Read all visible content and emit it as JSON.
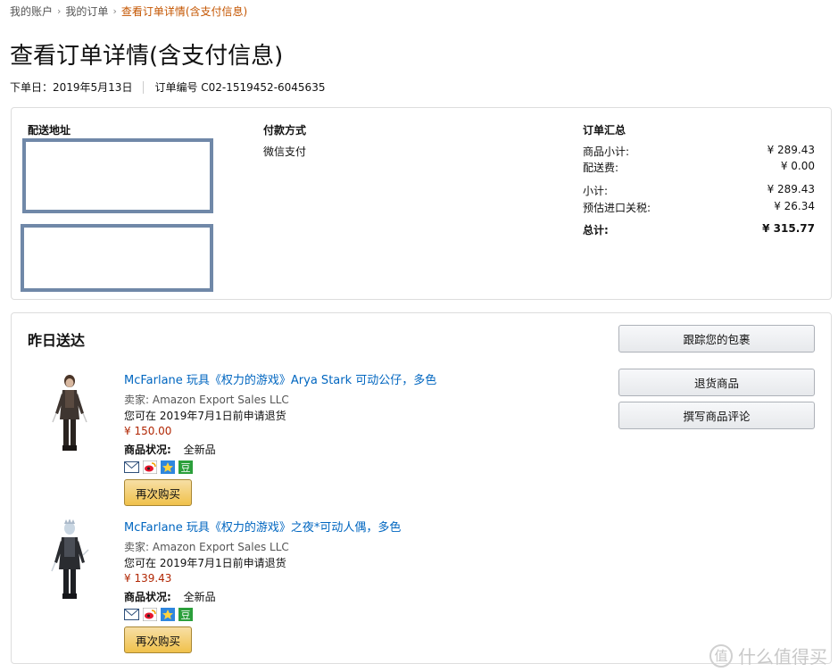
{
  "breadcrumb": {
    "items": [
      "我的账户",
      "我的订单",
      "查看订单详情(含支付信息)"
    ],
    "separator": "›"
  },
  "page": {
    "title": "查看订单详情(含支付信息)",
    "order_date": "下单日：2019年5月13日",
    "order_number": "订单编号 C02-1519452-6045635"
  },
  "info": {
    "shipping_heading": "配送地址",
    "payment_heading": "付款方式",
    "payment_method": "微信支付",
    "summary_heading": "订单汇总",
    "summary": [
      {
        "label": "商品小计:",
        "value": "¥ 289.43"
      },
      {
        "label": "配送费:",
        "value": "¥ 0.00"
      },
      {
        "label": "小计:",
        "value": "¥ 289.43"
      },
      {
        "label": "预估进口关税:",
        "value": "¥ 26.34"
      },
      {
        "label": "总计:",
        "value": "¥ 315.77"
      }
    ]
  },
  "shipment": {
    "status": "昨日送达",
    "track_button": "跟踪您的包裹",
    "return_button": "退货商品",
    "review_button": "撰写商品评论",
    "items": [
      {
        "title": "McFarlane 玩具《权力的游戏》Arya Stark 可动公仔，多色",
        "seller": "卖家: Amazon Export Sales LLC",
        "return_note": "您可在 2019年7月1日前申请退货",
        "price": "¥ 150.00",
        "condition_label": "商品状况:",
        "condition_value": "全新品",
        "buy_again": "再次购买"
      },
      {
        "title": "McFarlane 玩具《权力的游戏》之夜*可动人偶，多色",
        "seller": "卖家: Amazon Export Sales LLC",
        "return_note": "您可在 2019年7月1日前申请退货",
        "price": "¥ 139.43",
        "condition_label": "商品状况:",
        "condition_value": "全新品",
        "buy_again": "再次购买"
      }
    ],
    "share_icons": [
      "email-icon",
      "weibo-icon",
      "qzone-icon",
      "douban-icon"
    ]
  },
  "watermark": {
    "logo_glyph": "值",
    "text": "什么值得买"
  },
  "colors": {
    "link": "#0066c0",
    "price": "#b12704",
    "breadcrumb_current": "#c45500",
    "buy_again_button": "#f0c14b",
    "address_redaction_border": "#7088a8"
  }
}
